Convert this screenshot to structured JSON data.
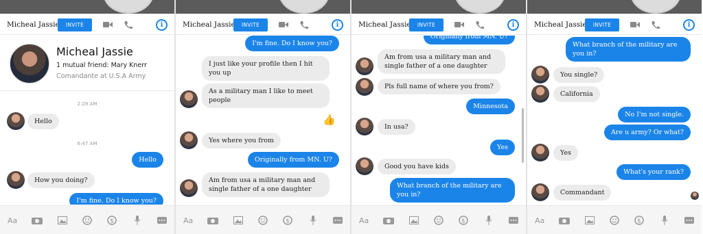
{
  "contact": {
    "name": "Micheal Jassie",
    "invite_label": "INVITE",
    "mutual": "1 mutual friend: Mary Knerr",
    "role": "Comandante at U.S.A Army"
  },
  "composer": {
    "text_icon": "Aa",
    "icons": [
      "camera-icon",
      "image-icon",
      "emoji-icon",
      "payment-icon",
      "microphone-icon",
      "more-icon"
    ]
  },
  "colors": {
    "accent": "#1b84e8",
    "incoming": "#ebebeb",
    "topbar": "#5b5b5b"
  },
  "panel1": {
    "time1": "2:28 AM",
    "msg1": "Hello",
    "time2": "6:47 AM",
    "msg2": "Hello",
    "msg3": "How you doing?",
    "msg4": "I'm fine. Do I know you?"
  },
  "panel2": {
    "msg1": "I'm fine. Do I know you?",
    "msg2": "I just like your profile then I hit you up",
    "msg3": "As a military man I like to meet people",
    "msg4": "Yes where you from",
    "msg5": "Originally from MN. U?",
    "msg6": "Am from usa a military man and single father of a one daughter"
  },
  "panel3": {
    "msg0": "Originally from MN. U?",
    "msg1": "Am from usa a military man and single father of a one daughter",
    "msg2": "Pls full name of where you from?",
    "msg3": "Minnesota",
    "msg4": "In usa?",
    "msg5": "Yes",
    "msg6": "Good you have kids",
    "msg7": "What branch of the military are you in?"
  },
  "panel4": {
    "msg1": "What branch of the military are you in?",
    "msg2": "You single?",
    "msg3": "California",
    "msg4": "No I'm not single.",
    "msg5": "Are u army? Or what?",
    "msg6": "Yes",
    "msg7": "What's your rank?",
    "msg8": "Commandant"
  }
}
